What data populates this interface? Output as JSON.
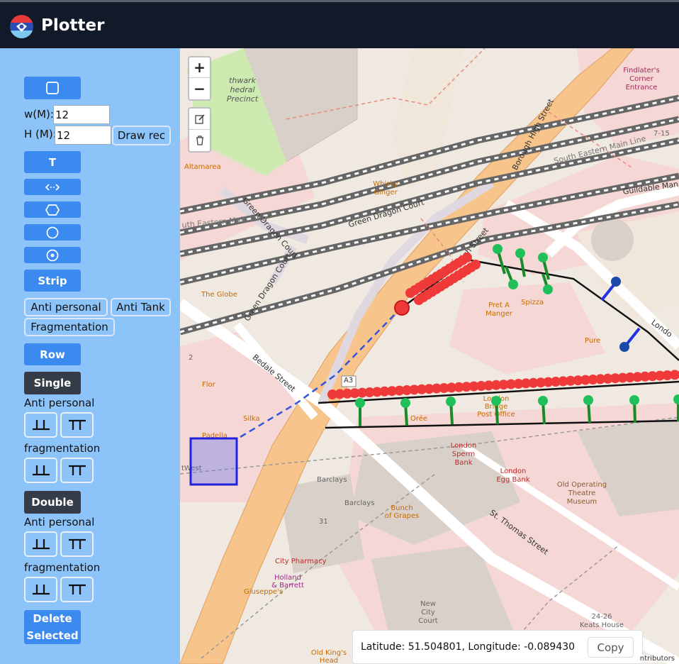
{
  "app": {
    "title": "Plotter"
  },
  "sidebar": {
    "rect_size": {
      "width_label": "w(M):",
      "width_value": "12",
      "height_label": "H (M):",
      "height_value": "12",
      "draw_rec_label": "Draw rec"
    },
    "text_button_label": "T",
    "strip_label": "Strip",
    "mine_types": [
      "Anti personal",
      "Anti Tank",
      "Fragmentation"
    ],
    "row_label": "Row",
    "single": {
      "label": "Single",
      "anti_personal_label": "Anti personal",
      "fragmentation_label": "fragmentation"
    },
    "double": {
      "label": "Double",
      "anti_personal_label": "Anti personal",
      "fragmentation_label": "fragmentation"
    },
    "delete_label_line1": "Delete",
    "delete_label_line2": "Selected"
  },
  "map": {
    "zoom_in": "+",
    "zoom_out": "−",
    "coordinates": "Latitude: 51.504801, Longitude: -0.089430",
    "copy_label": "Copy",
    "attribution": "ntributors",
    "labels": {
      "southwark": "thwark",
      "cathedral": "hedral",
      "precinct": "Precinct",
      "findlaters1": "Findlater's",
      "findlaters2": "Corner",
      "findlaters3": "Entrance",
      "altamarea": "Altamarea",
      "whisky1": "Whisky",
      "whisky2": "Ginger",
      "green_dragon_court_1": "Green Dragon Court",
      "green_dragon_court_2": "Green Dragon Court",
      "green_dragon_court_3": "Green Dragon Court",
      "green_dragon_court_4": "Green Dragon Court",
      "borough_high_street": "Borough High Street",
      "high_street": "High Street",
      "se_main_line_1": "South Eastern Main Line",
      "se_main_line_2": "uth Eastern Main Line",
      "guildable": "Guildable Man",
      "num_715": "7-15",
      "the_globe": "The Globe",
      "pret1": "Pret A",
      "pret2": "Manger",
      "spizza": "Spizza",
      "london": "Londo",
      "pure": "Pure",
      "bedale_street": "Bedale Street",
      "a3": "A3",
      "flor": "Flor",
      "silka": "Silka",
      "padella": "Padella",
      "twest": "tWest",
      "oree": "Orée",
      "post1": "London",
      "post2": "Bridge",
      "post3": "Post Office",
      "sperm1": "London",
      "sperm2": "Sperm",
      "sperm3": "Bank",
      "egg1": "London",
      "egg2": "Egg Bank",
      "theatre1": "Old Operating",
      "theatre2": "Theatre",
      "theatre3": "Museum",
      "barclays1": "Barclays",
      "barclays2": "Barclays",
      "bunch1": "Bunch",
      "bunch2": "of Grapes",
      "st_thomas": "St. Thomas Street",
      "num_31": "31",
      "pharmacy": "City Pharmacy",
      "holland1": "Holland",
      "holland2": "& Barrett",
      "giuseppes": "Giuseppe's",
      "ncc1": "New",
      "ncc2": "City",
      "ncc3": "Court",
      "num_2426": "24-26",
      "keats": "Keats House",
      "oldkings1": "Old King's",
      "oldkings2": "Head",
      "num_2": "2"
    }
  },
  "colors": {
    "topbar": "#121a2a",
    "sidebar": "#8cc3f9",
    "button": "#3b8aef",
    "button_dark": "#343c47",
    "mine_marker": "#f03a3a",
    "stake": "#1a8a2a",
    "stake_head": "#1fc05a",
    "selection": "#2222dd"
  },
  "icons": [
    "rectangle-icon",
    "arrow-lr-icon",
    "hexagon-icon",
    "circle-icon",
    "circle-dot-icon",
    "edit-icon",
    "trash-icon",
    "single-ap-icon",
    "single-frag-icon"
  ]
}
